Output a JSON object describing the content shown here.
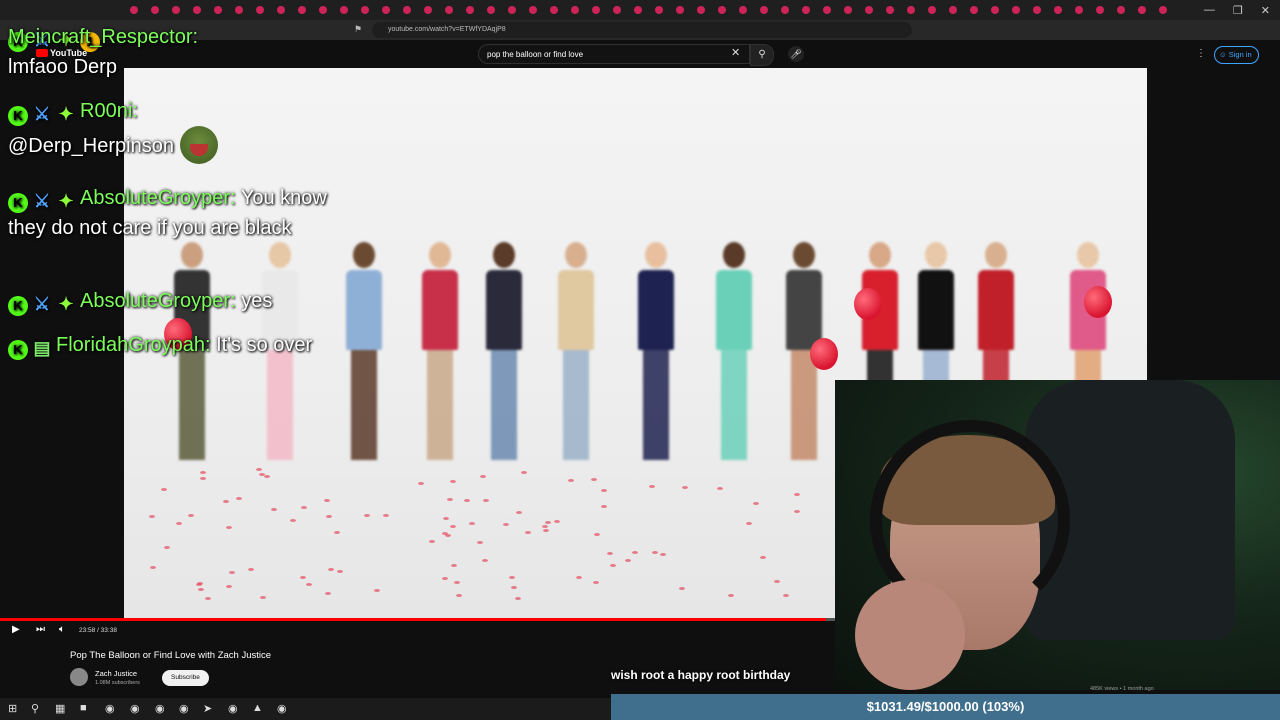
{
  "browser": {
    "url": "youtube.com/watch?v=ETWfYDAqjP8"
  },
  "youtube": {
    "logo": "YouTube",
    "search_value": "pop the balloon or find love",
    "signin_label": "Sign in"
  },
  "video": {
    "time": "23:58 / 33:38",
    "progress_percent": 72,
    "title": "Pop The Balloon or Find Love with Zach Justice",
    "channel": "Zach Justice",
    "subscribers": "1.08M subscribers",
    "subscribe_label": "Subscribe"
  },
  "chat": [
    {
      "user": "Meincraft_Respector:",
      "text": "lmfaoo Derp"
    },
    {
      "user": "R00ni:",
      "text": "@Derp_Herpinson"
    },
    {
      "user": "AbsoluteGroyper:",
      "text": "You know they do not care if you are black"
    },
    {
      "user": "AbsoluteGroyper:",
      "text": "yes"
    },
    {
      "user": "FloridahGroypah:",
      "text": "It's so over"
    }
  ],
  "caption": "wish root a happy root birthday",
  "donation": {
    "text": "$1031.49/$1000.00 (103%)",
    "percent": 103
  },
  "overlay_views": "485K views • 1 month ago",
  "colors": {
    "chat_username": "#7dff5a",
    "progress": "#ff0000",
    "donation_bar": "#3f6f8c"
  }
}
